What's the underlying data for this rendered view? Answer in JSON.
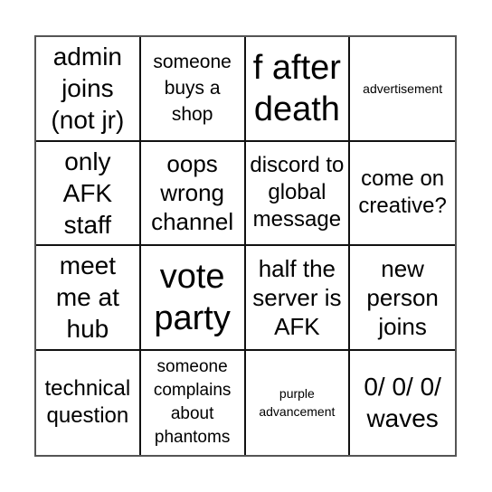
{
  "card": {
    "colors": {
      "outer_border": "#555555",
      "inner_lines": "#111111",
      "background": "#ffffff",
      "text": "#000000"
    },
    "cells": [
      {
        "text": "admin joins (not jr)"
      },
      {
        "text": "someone buys a shop"
      },
      {
        "text": "f after death"
      },
      {
        "text": "advertisement"
      },
      {
        "text": "only AFK staff"
      },
      {
        "text": "oops wrong channel"
      },
      {
        "text": "discord to global message"
      },
      {
        "text": "come on creative?"
      },
      {
        "text": "meet me at hub"
      },
      {
        "text": "vote party"
      },
      {
        "text": "half the server is AFK"
      },
      {
        "text": "new person joins"
      },
      {
        "text": "technical question"
      },
      {
        "text": "someone complains about phantoms"
      },
      {
        "text": "purple advancement"
      },
      {
        "text": "0/ 0/ 0/ waves"
      }
    ]
  }
}
